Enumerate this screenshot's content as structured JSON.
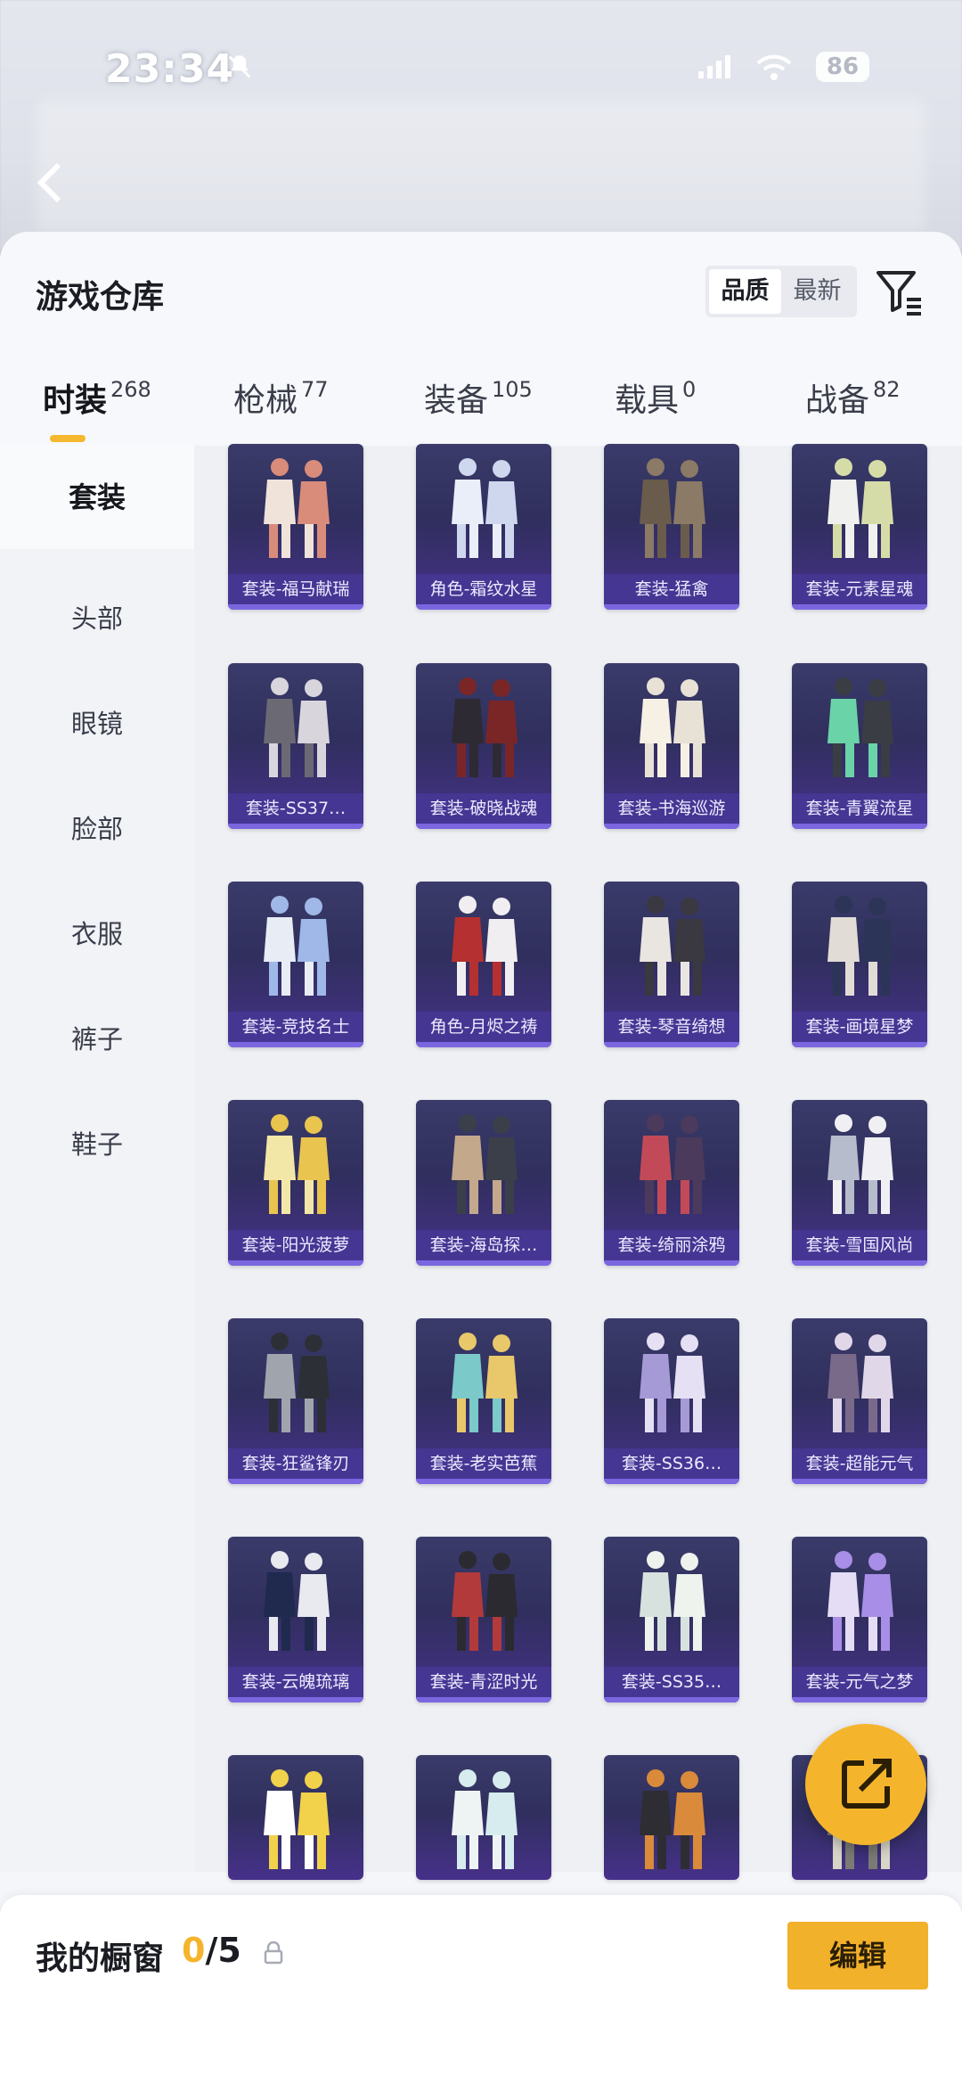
{
  "status_bar": {
    "time": "23:34",
    "battery": "86"
  },
  "header": {
    "title": "游戏仓库",
    "sort_options": [
      "品质",
      "最新"
    ],
    "sort_active": "品质"
  },
  "tabs": [
    {
      "label": "时装",
      "count": "268"
    },
    {
      "label": "枪械",
      "count": "77"
    },
    {
      "label": "装备",
      "count": "105"
    },
    {
      "label": "载具",
      "count": "0"
    },
    {
      "label": "战备",
      "count": "82"
    }
  ],
  "sidebar": {
    "items": [
      "套装",
      "头部",
      "眼镜",
      "脸部",
      "衣服",
      "裤子",
      "鞋子"
    ]
  },
  "items": [
    "套装-福马献瑞",
    "角色-霜纹水星",
    "套装-猛禽",
    "套装-元素星魂",
    "套装-SS37…",
    "套装-破晓战魂",
    "套装-书海巡游",
    "套装-青翼流星",
    "套装-竞技名士",
    "角色-月烬之祷",
    "套装-琴音绮想",
    "套装-画境星梦",
    "套装-阳光菠萝",
    "套装-海岛探…",
    "套装-绮丽涂鸦",
    "套装-雪国风尚",
    "套装-狂鲨锋刃",
    "套装-老实芭蕉",
    "套装-SS36…",
    "套装-超能元气",
    "套装-云魄琉璃",
    "套装-青涩时光",
    "套装-SS35…",
    "套装-元气之梦",
    "",
    "",
    "",
    ""
  ],
  "showcase": {
    "label": "我的橱窗",
    "current": "0",
    "total": "/5",
    "edit_label": "编辑"
  },
  "colors": {
    "accent": "#f4b52c",
    "card_bg": "#3a3b6a",
    "card_label": "#4637a0"
  }
}
